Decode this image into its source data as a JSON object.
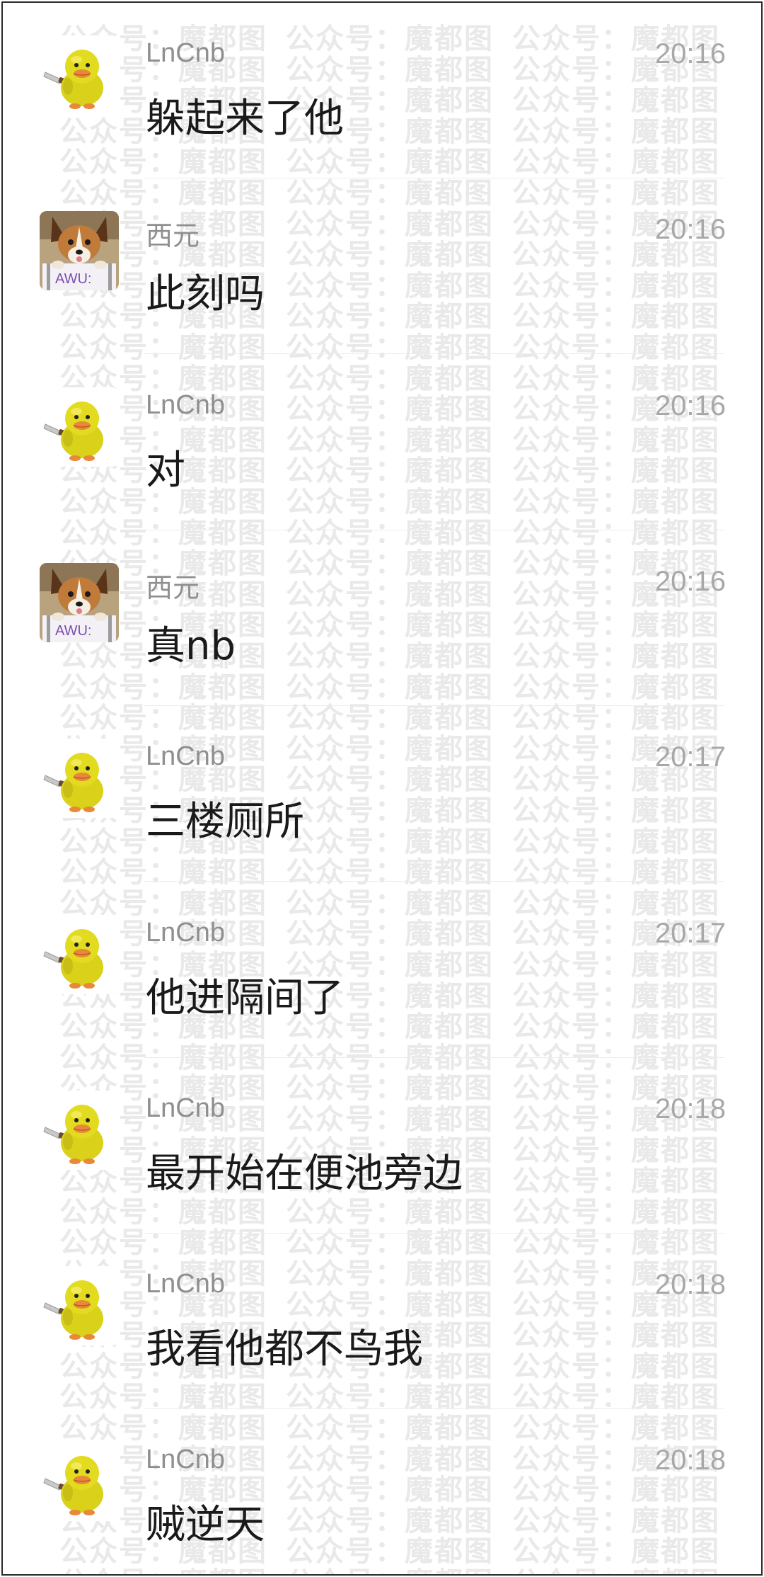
{
  "watermark": "公众号：魔都图",
  "avatars": {
    "LnCnb": "duck-with-knife",
    "西元": "dog-photo",
    "dog_label": "AWU:"
  },
  "messages": [
    {
      "sender": "LnCnb",
      "time": "20:16",
      "text": "躲起来了他"
    },
    {
      "sender": "西元",
      "time": "20:16",
      "text": "此刻吗"
    },
    {
      "sender": "LnCnb",
      "time": "20:16",
      "text": "对"
    },
    {
      "sender": "西元",
      "time": "20:16",
      "text": "真nb"
    },
    {
      "sender": "LnCnb",
      "time": "20:17",
      "text": "三楼厕所"
    },
    {
      "sender": "LnCnb",
      "time": "20:17",
      "text": "他进隔间了"
    },
    {
      "sender": "LnCnb",
      "time": "20:18",
      "text": "最开始在便池旁边"
    },
    {
      "sender": "LnCnb",
      "time": "20:18",
      "text": "我看他都不鸟我"
    },
    {
      "sender": "LnCnb",
      "time": "20:18",
      "text": "贼逆天"
    }
  ]
}
